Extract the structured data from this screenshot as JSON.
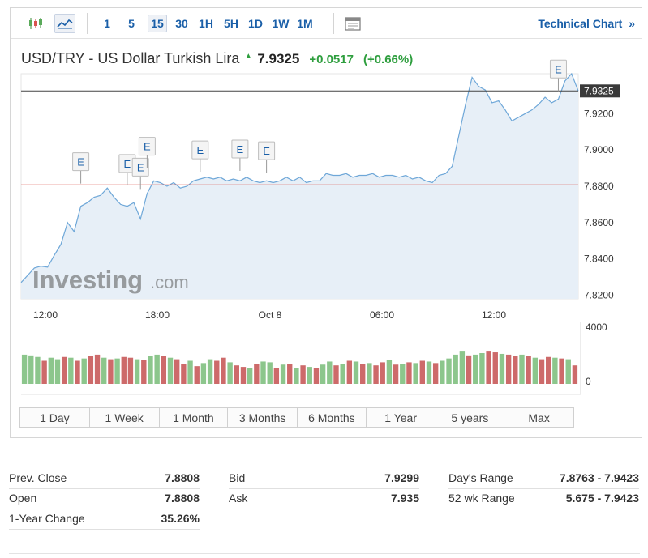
{
  "toolbar": {
    "intervals": [
      "1",
      "5",
      "15",
      "30",
      "1H",
      "5H",
      "1D",
      "1W",
      "1M"
    ],
    "active_interval": "15",
    "technical_label": "Technical Chart",
    "technical_arrow": "»"
  },
  "header": {
    "title": "USD/TRY - US Dollar Turkish Lira",
    "arrow": "▲",
    "price": "7.9325",
    "change": "+0.0517",
    "change_pct": "(+0.66%)"
  },
  "watermark": {
    "brand": "Investing",
    "suffix": ".com"
  },
  "colors": {
    "line": "#6ea7d8",
    "area": "#e7eff7",
    "prev_close_line": "#d9534f",
    "up_volume": "#8cc68c",
    "down_volume": "#cd6a6a",
    "positive": "#2e9e3e",
    "link": "#1a5fa8"
  },
  "chart_data": {
    "type": "area",
    "title": "USD/TRY - US Dollar Turkish Lira",
    "x_tick_labels": [
      "12:00",
      "18:00",
      "Oct 8",
      "06:00",
      "12:00"
    ],
    "y_tick_labels": [
      "7.9200",
      "7.9000",
      "7.8800",
      "7.8600",
      "7.8400",
      "7.8200"
    ],
    "ylim": [
      7.818,
      7.942
    ],
    "grid": false,
    "current_price_label": "7.9325",
    "current_price": 7.9325,
    "prev_close": 7.8808,
    "event_marker_label": "E",
    "event_markers": [
      {
        "index": 9,
        "value": 7.8815
      },
      {
        "index": 16,
        "value": 7.8805
      },
      {
        "index": 18,
        "value": 7.8785
      },
      {
        "index": 19,
        "value": 7.89
      },
      {
        "index": 27,
        "value": 7.888
      },
      {
        "index": 33,
        "value": 7.8885
      },
      {
        "index": 37,
        "value": 7.8875
      },
      {
        "index": 81,
        "value": 7.9325
      }
    ],
    "series": [
      {
        "values": [
          7.827,
          7.831,
          7.835,
          7.836,
          7.8355,
          7.842,
          7.848,
          7.86,
          7.855,
          7.869,
          7.871,
          7.874,
          7.875,
          7.879,
          7.874,
          7.87,
          7.869,
          7.871,
          7.862,
          7.876,
          7.883,
          7.882,
          7.88,
          7.882,
          7.879,
          7.88,
          7.883,
          7.884,
          7.885,
          7.884,
          7.885,
          7.883,
          7.884,
          7.883,
          7.885,
          7.883,
          7.882,
          7.883,
          7.882,
          7.883,
          7.885,
          7.883,
          7.885,
          7.882,
          7.883,
          7.883,
          7.887,
          7.886,
          7.886,
          7.887,
          7.885,
          7.886,
          7.886,
          7.887,
          7.885,
          7.886,
          7.886,
          7.885,
          7.886,
          7.884,
          7.885,
          7.883,
          7.882,
          7.886,
          7.887,
          7.891,
          7.908,
          7.925,
          7.94,
          7.935,
          7.933,
          7.926,
          7.927,
          7.922,
          7.916,
          7.918,
          7.92,
          7.922,
          7.925,
          7.929,
          7.926,
          7.928,
          7.938,
          7.942,
          7.9325
        ]
      }
    ],
    "volume": {
      "ylim": [
        0,
        4000
      ],
      "tick_labels": [
        "4000",
        "0"
      ],
      "values": [
        1900,
        1850,
        1750,
        1500,
        1700,
        1600,
        1750,
        1700,
        1500,
        1650,
        1800,
        1900,
        1700,
        1600,
        1650,
        1750,
        1700,
        1600,
        1550,
        1800,
        1900,
        1800,
        1700,
        1600,
        1300,
        1500,
        1150,
        1350,
        1600,
        1500,
        1700,
        1400,
        1200,
        1100,
        1000,
        1300,
        1450,
        1400,
        1050,
        1250,
        1300,
        1000,
        1200,
        1100,
        1050,
        1250,
        1450,
        1200,
        1300,
        1500,
        1450,
        1300,
        1350,
        1200,
        1400,
        1550,
        1250,
        1300,
        1400,
        1350,
        1500,
        1450,
        1350,
        1500,
        1650,
        1900,
        2100,
        1850,
        1900,
        2000,
        2100,
        2050,
        1950,
        1900,
        1800,
        1900,
        1800,
        1700,
        1600,
        1750,
        1700,
        1650,
        1600,
        1200
      ],
      "direction": [
        1,
        1,
        1,
        0,
        1,
        1,
        0,
        1,
        0,
        1,
        0,
        0,
        1,
        0,
        1,
        0,
        0,
        1,
        0,
        1,
        1,
        0,
        1,
        0,
        0,
        1,
        0,
        1,
        1,
        0,
        0,
        1,
        0,
        0,
        1,
        0,
        1,
        1,
        0,
        1,
        0,
        1,
        0,
        1,
        0,
        1,
        1,
        0,
        1,
        0,
        1,
        0,
        1,
        0,
        0,
        1,
        0,
        1,
        0,
        1,
        0,
        1,
        0,
        1,
        1,
        1,
        1,
        0,
        1,
        1,
        0,
        0,
        1,
        0,
        0,
        1,
        0,
        1,
        0,
        0,
        1,
        0,
        1,
        0
      ]
    }
  },
  "periods": [
    "1 Day",
    "1 Week",
    "1 Month",
    "3 Months",
    "6 Months",
    "1 Year",
    "5 years",
    "Max"
  ],
  "stats": [
    [
      {
        "label": "Prev. Close",
        "value": "7.8808"
      },
      {
        "label": "Open",
        "value": "7.8808"
      },
      {
        "label": "1-Year Change",
        "value": "35.26%"
      }
    ],
    [
      {
        "label": "Bid",
        "value": "7.9299"
      },
      {
        "label": "Ask",
        "value": "7.935"
      }
    ],
    [
      {
        "label": "Day's Range",
        "value": "7.8763 - 7.9423"
      },
      {
        "label": "52 wk Range",
        "value": "5.675 - 7.9423"
      }
    ]
  ]
}
